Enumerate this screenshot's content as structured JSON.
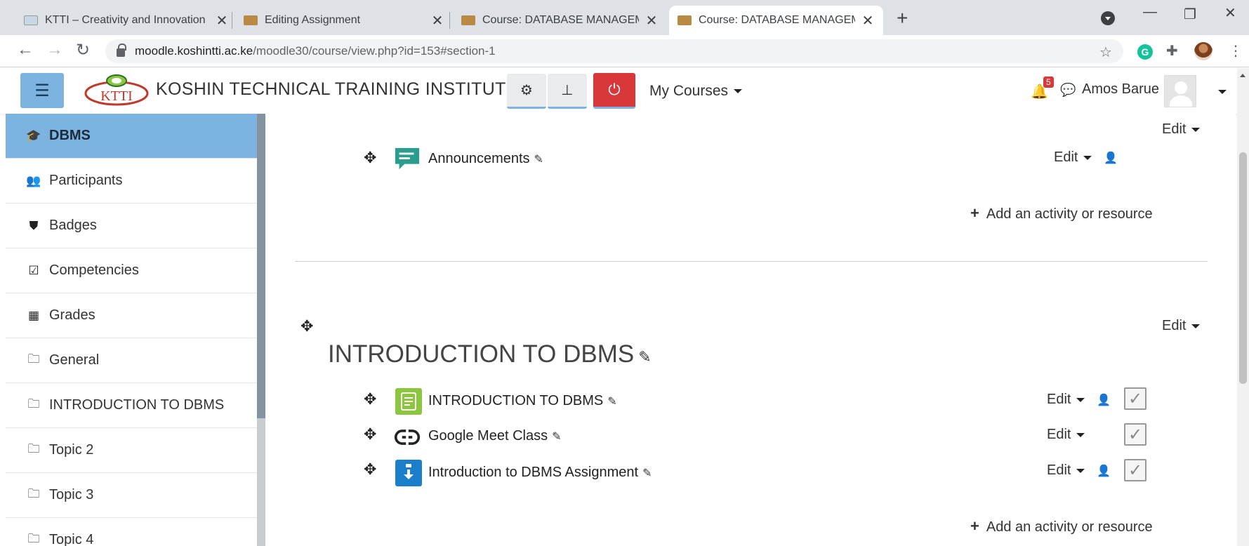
{
  "browser": {
    "tabs": [
      {
        "title": "KTTI – Creativity and Innovation",
        "active": false
      },
      {
        "title": "Editing Assignment",
        "active": false
      },
      {
        "title": "Course: DATABASE MANAGEMEN",
        "active": false
      },
      {
        "title": "Course: DATABASE MANAGEMEN",
        "active": true
      }
    ],
    "url_host": "moodle.koshintti.ac.ke",
    "url_path": "/moodle30/course/view.php?id=153#section-1"
  },
  "navbar": {
    "site_name": "KOSHIN TECHNICAL TRAINING INSTITUTE",
    "logo_text": "KTTI",
    "my_courses": "My Courses",
    "notification_count": "5",
    "user_name": "Amos Barue"
  },
  "drawer": {
    "items": [
      {
        "label": "DBMS",
        "icon": "graduation-cap-icon"
      },
      {
        "label": "Participants",
        "icon": "users-icon"
      },
      {
        "label": "Badges",
        "icon": "shield-icon"
      },
      {
        "label": "Competencies",
        "icon": "checkbox-icon"
      },
      {
        "label": "Grades",
        "icon": "table-icon"
      },
      {
        "label": "General",
        "icon": "folder-icon"
      },
      {
        "label": "INTRODUCTION TO DBMS",
        "icon": "folder-icon"
      },
      {
        "label": "Topic 2",
        "icon": "folder-icon"
      },
      {
        "label": "Topic 3",
        "icon": "folder-icon"
      },
      {
        "label": "Topic 4",
        "icon": "folder-icon"
      }
    ]
  },
  "content": {
    "edit_label": "Edit",
    "add_activity_label": "Add an activity or resource",
    "section0": {
      "activities": [
        {
          "name": "Announcements",
          "icon": "forum-icon",
          "color": "#2a9d8f"
        }
      ]
    },
    "section1": {
      "title": "INTRODUCTION TO DBMS",
      "activities": [
        {
          "name": "INTRODUCTION TO DBMS",
          "icon": "page-icon",
          "color": "#8cc63f"
        },
        {
          "name": "Google Meet Class",
          "icon": "url-link-icon",
          "color": "#222222"
        },
        {
          "name": "Introduction to DBMS Assignment",
          "icon": "assignment-icon",
          "color": "#1a7ecb"
        }
      ]
    }
  },
  "colors": {
    "accent": "#7cb3e0",
    "power_button": "#d9383a"
  }
}
